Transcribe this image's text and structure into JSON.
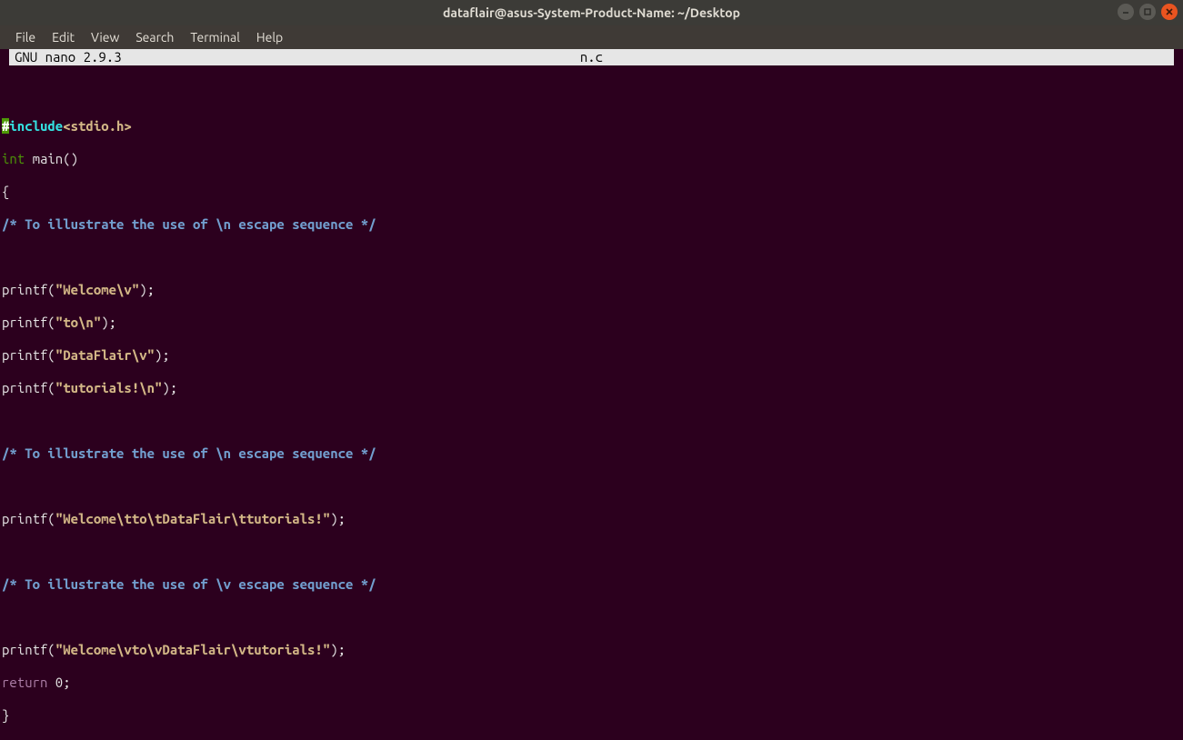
{
  "window": {
    "title": "dataflair@asus-System-Product-Name: ~/Desktop"
  },
  "menu": {
    "file": "File",
    "edit": "Edit",
    "view": "View",
    "search": "Search",
    "terminal": "Terminal",
    "help": "Help"
  },
  "nano": {
    "version": "  GNU nano 2.9.3",
    "filename": "n.c"
  },
  "code": {
    "hash": "#",
    "include_kw": "include",
    "include_hdr": "<stdio.h>",
    "int": "int",
    "main_decl": " main()",
    "brace_open": "{",
    "comment1": "/* To illustrate the use of \\n escape sequence */",
    "p1a": "printf(",
    "p1b": "\"Welcome\\v\"",
    "p1c": ");",
    "p2a": "printf(",
    "p2b": "\"to\\n\"",
    "p2c": ");",
    "p3a": "printf(",
    "p3b": "\"DataFlair\\v\"",
    "p3c": ");",
    "p4a": "printf(",
    "p4b": "\"tutorials!\\n\"",
    "p4c": ");",
    "comment2": "/* To illustrate the use of \\n escape sequence */",
    "p5a": "printf(",
    "p5b": "\"Welcome\\tto\\tDataFlair\\ttutorials!\"",
    "p5c": ");",
    "comment3": "/* To illustrate the use of \\v escape sequence */",
    "p6a": "printf(",
    "p6b": "\"Welcome\\vto\\vDataFlair\\vtutorials!\"",
    "p6c": ");",
    "return_kw": "return",
    "return_rest": " 0;",
    "brace_close": "}"
  }
}
